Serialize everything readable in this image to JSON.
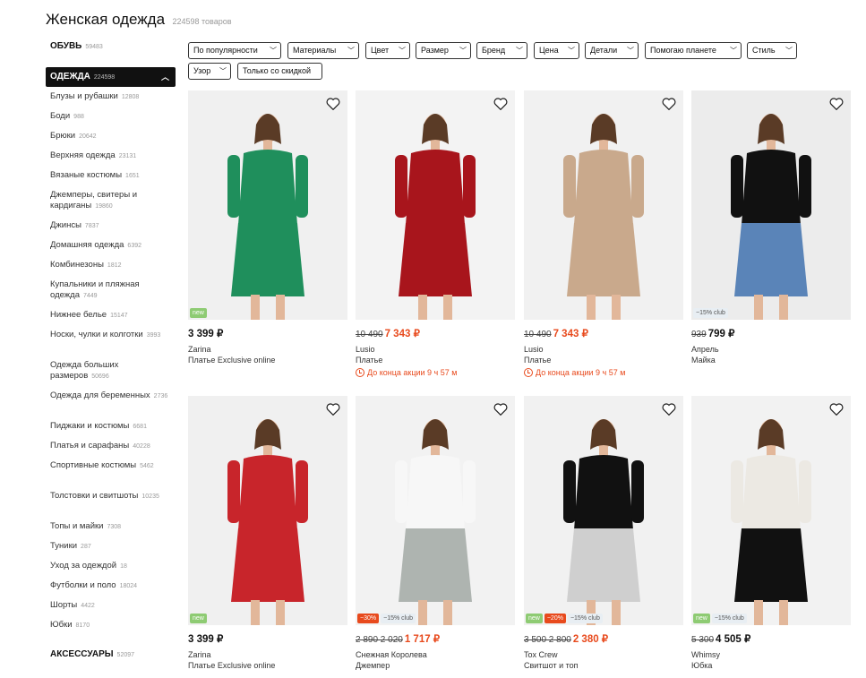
{
  "page": {
    "title": "Женская одежда",
    "count": "224598 товаров"
  },
  "sidebar": {
    "shoes": {
      "label": "ОБУВЬ",
      "count": "59483"
    },
    "clothing": {
      "label": "ОДЕЖДА",
      "count": "224598"
    },
    "items": [
      {
        "label": "Блузы и рубашки",
        "count": "12808"
      },
      {
        "label": "Боди",
        "count": "988"
      },
      {
        "label": "Брюки",
        "count": "20642"
      },
      {
        "label": "Верхняя одежда",
        "count": "23131"
      },
      {
        "label": "Вязаные костюмы",
        "count": "1651"
      },
      {
        "label": "Джемперы, свитеры и кардиганы",
        "count": "19860"
      },
      {
        "label": "Джинсы",
        "count": "7837"
      },
      {
        "label": "Домашняя одежда",
        "count": "6392"
      },
      {
        "label": "Комбинезоны",
        "count": "1812"
      },
      {
        "label": "Купальники и пляжная одежда",
        "count": "7449"
      },
      {
        "label": "Нижнее белье",
        "count": "15147"
      },
      {
        "label": "Носки, чулки и колготки",
        "count": "3993"
      },
      {
        "label": "Одежда больших размеров",
        "count": "50696"
      },
      {
        "label": "Одежда для беременных",
        "count": "2736"
      },
      {
        "label": "Пиджаки и костюмы",
        "count": "6681"
      },
      {
        "label": "Платья и сарафаны",
        "count": "40228"
      },
      {
        "label": "Спортивные костюмы",
        "count": "5462"
      },
      {
        "label": "Толстовки и свитшоты",
        "count": "10235"
      },
      {
        "label": "Топы и майки",
        "count": "7308"
      },
      {
        "label": "Туники",
        "count": "287"
      },
      {
        "label": "Уход за одеждой",
        "count": "18"
      },
      {
        "label": "Футболки и поло",
        "count": "18024"
      },
      {
        "label": "Шорты",
        "count": "4422"
      },
      {
        "label": "Юбки",
        "count": "8170"
      }
    ],
    "accessories": {
      "label": "АКСЕССУАРЫ",
      "count": "52097"
    }
  },
  "filters": [
    "По популярности",
    "Материалы",
    "Цвет",
    "Размер",
    "Бренд",
    "Цена",
    "Детали",
    "Помогаю планете",
    "Стиль",
    "Узор",
    "Только со скидкой"
  ],
  "products": [
    {
      "old": "",
      "price": "3 399 ₽",
      "sale": false,
      "brand": "Zarina",
      "type": "Платье Exclusive online",
      "promo": "",
      "badges": [
        "new"
      ],
      "colors": {
        "bg": "#f0f0f0",
        "top": "#1f8f5c",
        "bottom": "#1f8f5c"
      }
    },
    {
      "old": "10 490",
      "price": "7 343 ₽",
      "sale": true,
      "brand": "Lusio",
      "type": "Платье",
      "promo": "До конца акции 9 ч 57 м",
      "badges": [],
      "colors": {
        "bg": "#f3f3f3",
        "top": "#a8151c",
        "bottom": "#a8151c"
      }
    },
    {
      "old": "10 490",
      "price": "7 343 ₽",
      "sale": true,
      "brand": "Lusio",
      "type": "Платье",
      "promo": "До конца акции 9 ч 57 м",
      "badges": [],
      "colors": {
        "bg": "#f1f1f1",
        "top": "#c9a98c",
        "bottom": "#c9a98c"
      }
    },
    {
      "old": "939",
      "price": "799 ₽",
      "sale": false,
      "brand": "Апрель",
      "type": "Майка",
      "promo": "",
      "badges": [
        "−15% club"
      ],
      "colors": {
        "bg": "#ececec",
        "top": "#111111",
        "bottom": "#5a84b8"
      }
    },
    {
      "old": "",
      "price": "3 399 ₽",
      "sale": false,
      "brand": "Zarina",
      "type": "Платье Exclusive online",
      "promo": "",
      "badges": [
        "new"
      ],
      "colors": {
        "bg": "#f0f0f0",
        "top": "#c8252b",
        "bottom": "#c8252b"
      }
    },
    {
      "old": "2 890 2 020",
      "price": "1 717 ₽",
      "sale": true,
      "brand": "Снежная Королева",
      "type": "Джемпер",
      "promo": "",
      "badges": [
        "−30%",
        "−15% club"
      ],
      "colors": {
        "bg": "#f2f2f2",
        "top": "#f7f7f7",
        "bottom": "#aeb4b0"
      }
    },
    {
      "old": "3 500 2 800",
      "price": "2 380 ₽",
      "sale": true,
      "brand": "Tox Crew",
      "type": "Свитшот и топ",
      "promo": "",
      "badges": [
        "new",
        "−20%",
        "−15% club"
      ],
      "colors": {
        "bg": "#f1f1f1",
        "top": "#111111",
        "bottom": "#cfcfcf"
      }
    },
    {
      "old": "5 300",
      "price": "4 505 ₽",
      "sale": false,
      "brand": "Whimsy",
      "type": "Юбка",
      "promo": "",
      "badges": [
        "new",
        "−15% club"
      ],
      "colors": {
        "bg": "#f2f2f2",
        "top": "#ece9e3",
        "bottom": "#111111"
      }
    }
  ]
}
